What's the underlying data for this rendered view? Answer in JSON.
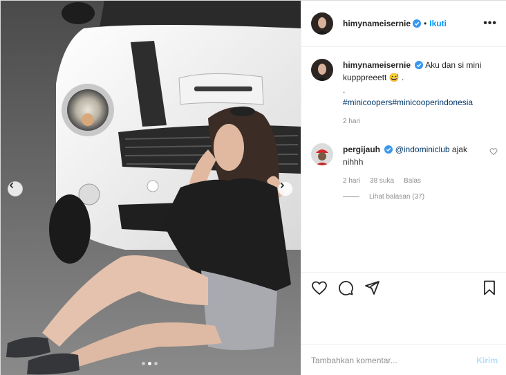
{
  "post": {
    "author": "himynameisernie",
    "follow_label": "Ikuti",
    "header_separator": "•",
    "more_label": "•••"
  },
  "caption": {
    "author": "himynameisernie",
    "text": "Aku dan si mini kupppreeett 😅 .",
    "dot_line": ".",
    "hashtags": "#minicoopers#minicooperindonesia",
    "time": "2 hari"
  },
  "comments": [
    {
      "author": "pergijauh",
      "mention": "@indominiclub",
      "text": " ajak nihhh",
      "time": "2 hari",
      "likes": "38 suka",
      "reply_label": "Balas",
      "view_replies": "Lihat balasan (37)"
    }
  ],
  "add_comment": {
    "placeholder": "Tambahkan komentar...",
    "post_label": "Kirim"
  },
  "icons": {
    "like": "heart-icon",
    "comment": "comment-bubble-icon",
    "share": "paper-plane-icon",
    "save": "bookmark-icon",
    "verified": "verified-badge-icon"
  },
  "colors": {
    "accent": "#0095f6",
    "verified": "#3897f0",
    "link": "#00376b",
    "muted": "#8e8e8e"
  },
  "carousel": {
    "slide_count": 3,
    "active_index": 1
  }
}
